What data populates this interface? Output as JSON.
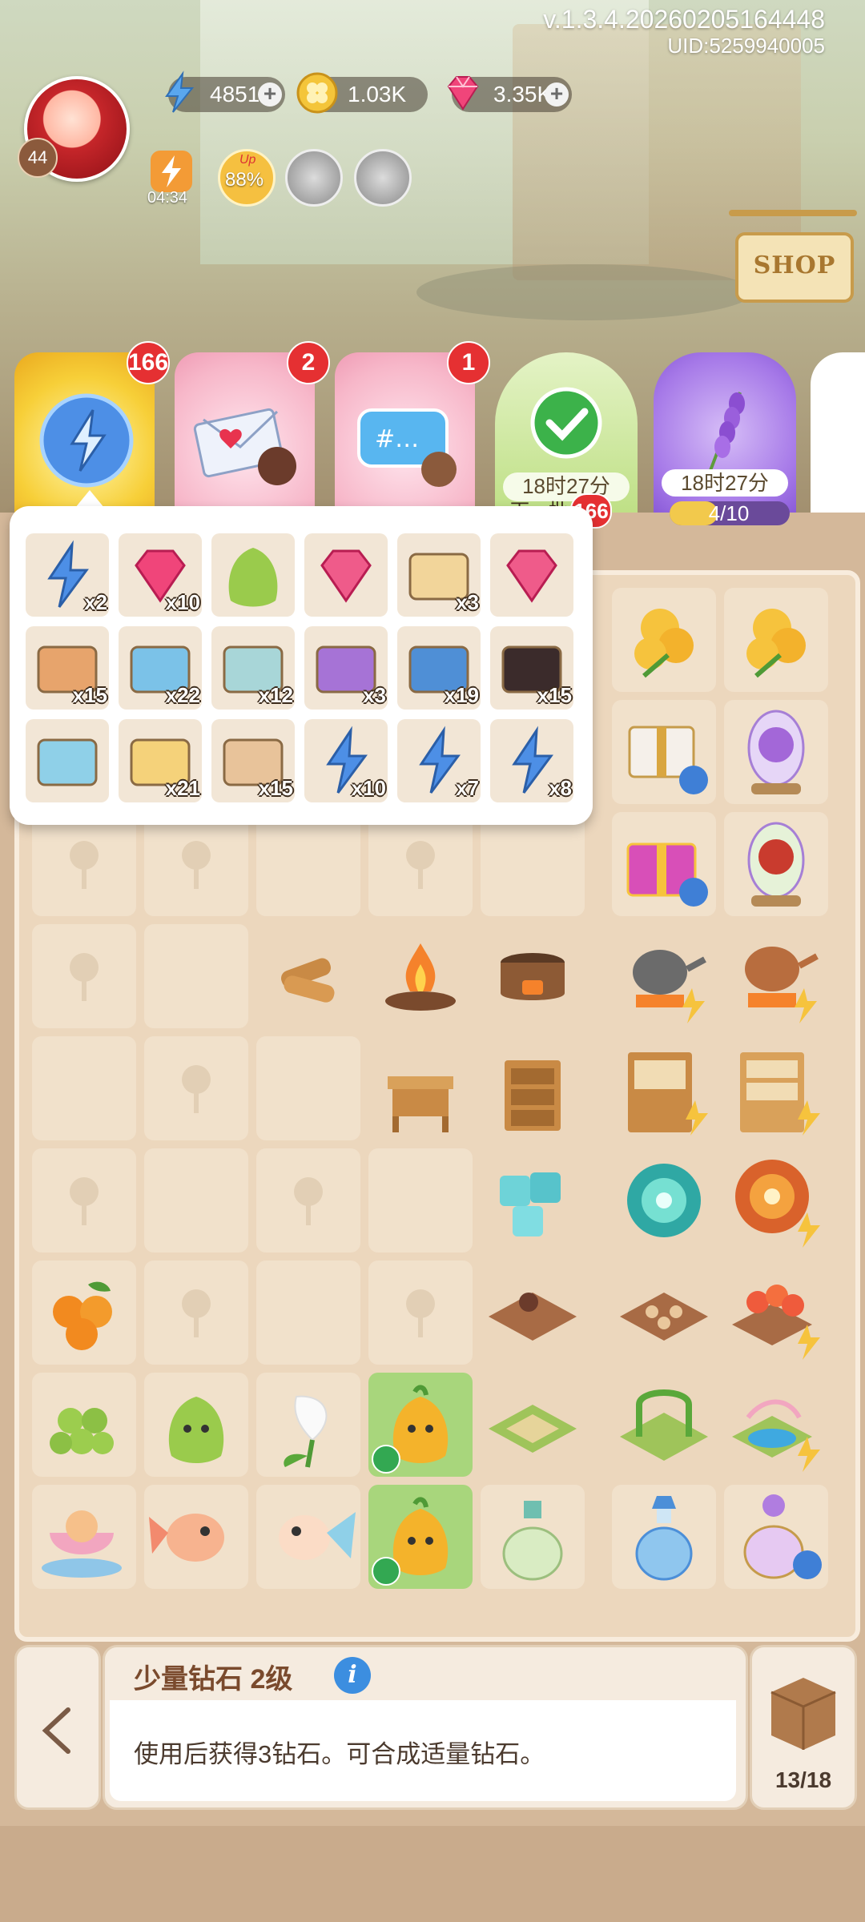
{
  "header": {
    "version": "v.1.3.4.20260205164448",
    "uid": "UID:5259940005",
    "level": "44"
  },
  "resources": {
    "energy": "4851",
    "clover": "1.03K",
    "diamond": "3.35K"
  },
  "buffs": {
    "energy_timer": "04:34",
    "boost_percent": "88%",
    "boost_label": "Up"
  },
  "cards": {
    "energy_badge": "166",
    "mail_badge": "2",
    "chat_badge": "1",
    "daily_timer": "18时27分",
    "daily_sub": "下一批",
    "daily_tag": "166",
    "lavender_timer": "18时27分",
    "lavender_progress": "4/10",
    "lavender_progress_value": 0.4
  },
  "shop": {
    "label": "SHOP"
  },
  "popup": {
    "items": [
      {
        "icon": "energy-orb",
        "qty": "x2"
      },
      {
        "icon": "small-diamond",
        "qty": "x10"
      },
      {
        "icon": "green-pepper-creature",
        "qty": ""
      },
      {
        "icon": "diamond-pile",
        "qty": ""
      },
      {
        "icon": "flower-box",
        "qty": "x3"
      },
      {
        "icon": "diamond-cluster",
        "qty": ""
      },
      {
        "icon": "gift-box-round",
        "qty": "x15"
      },
      {
        "icon": "colorful-box",
        "qty": "x22"
      },
      {
        "icon": "water-drop-box",
        "qty": "x12"
      },
      {
        "icon": "treasure-box-purple",
        "qty": "x3"
      },
      {
        "icon": "blue-suitcase",
        "qty": "x19"
      },
      {
        "icon": "black-suitcase",
        "qty": "x15"
      },
      {
        "icon": "mystery-box",
        "qty": ""
      },
      {
        "icon": "rainbow-card",
        "qty": "x21"
      },
      {
        "icon": "bottle-card",
        "qty": "x15"
      },
      {
        "icon": "energy-bolt-single",
        "qty": "x10"
      },
      {
        "icon": "energy-bolt-double",
        "qty": "x7"
      },
      {
        "icon": "energy-bolt-triple",
        "qty": "x8"
      }
    ]
  },
  "info": {
    "title": "少量钻石 2级",
    "description": "使用后获得3钻石。可合成适量钻石。",
    "storage": "13/18"
  }
}
